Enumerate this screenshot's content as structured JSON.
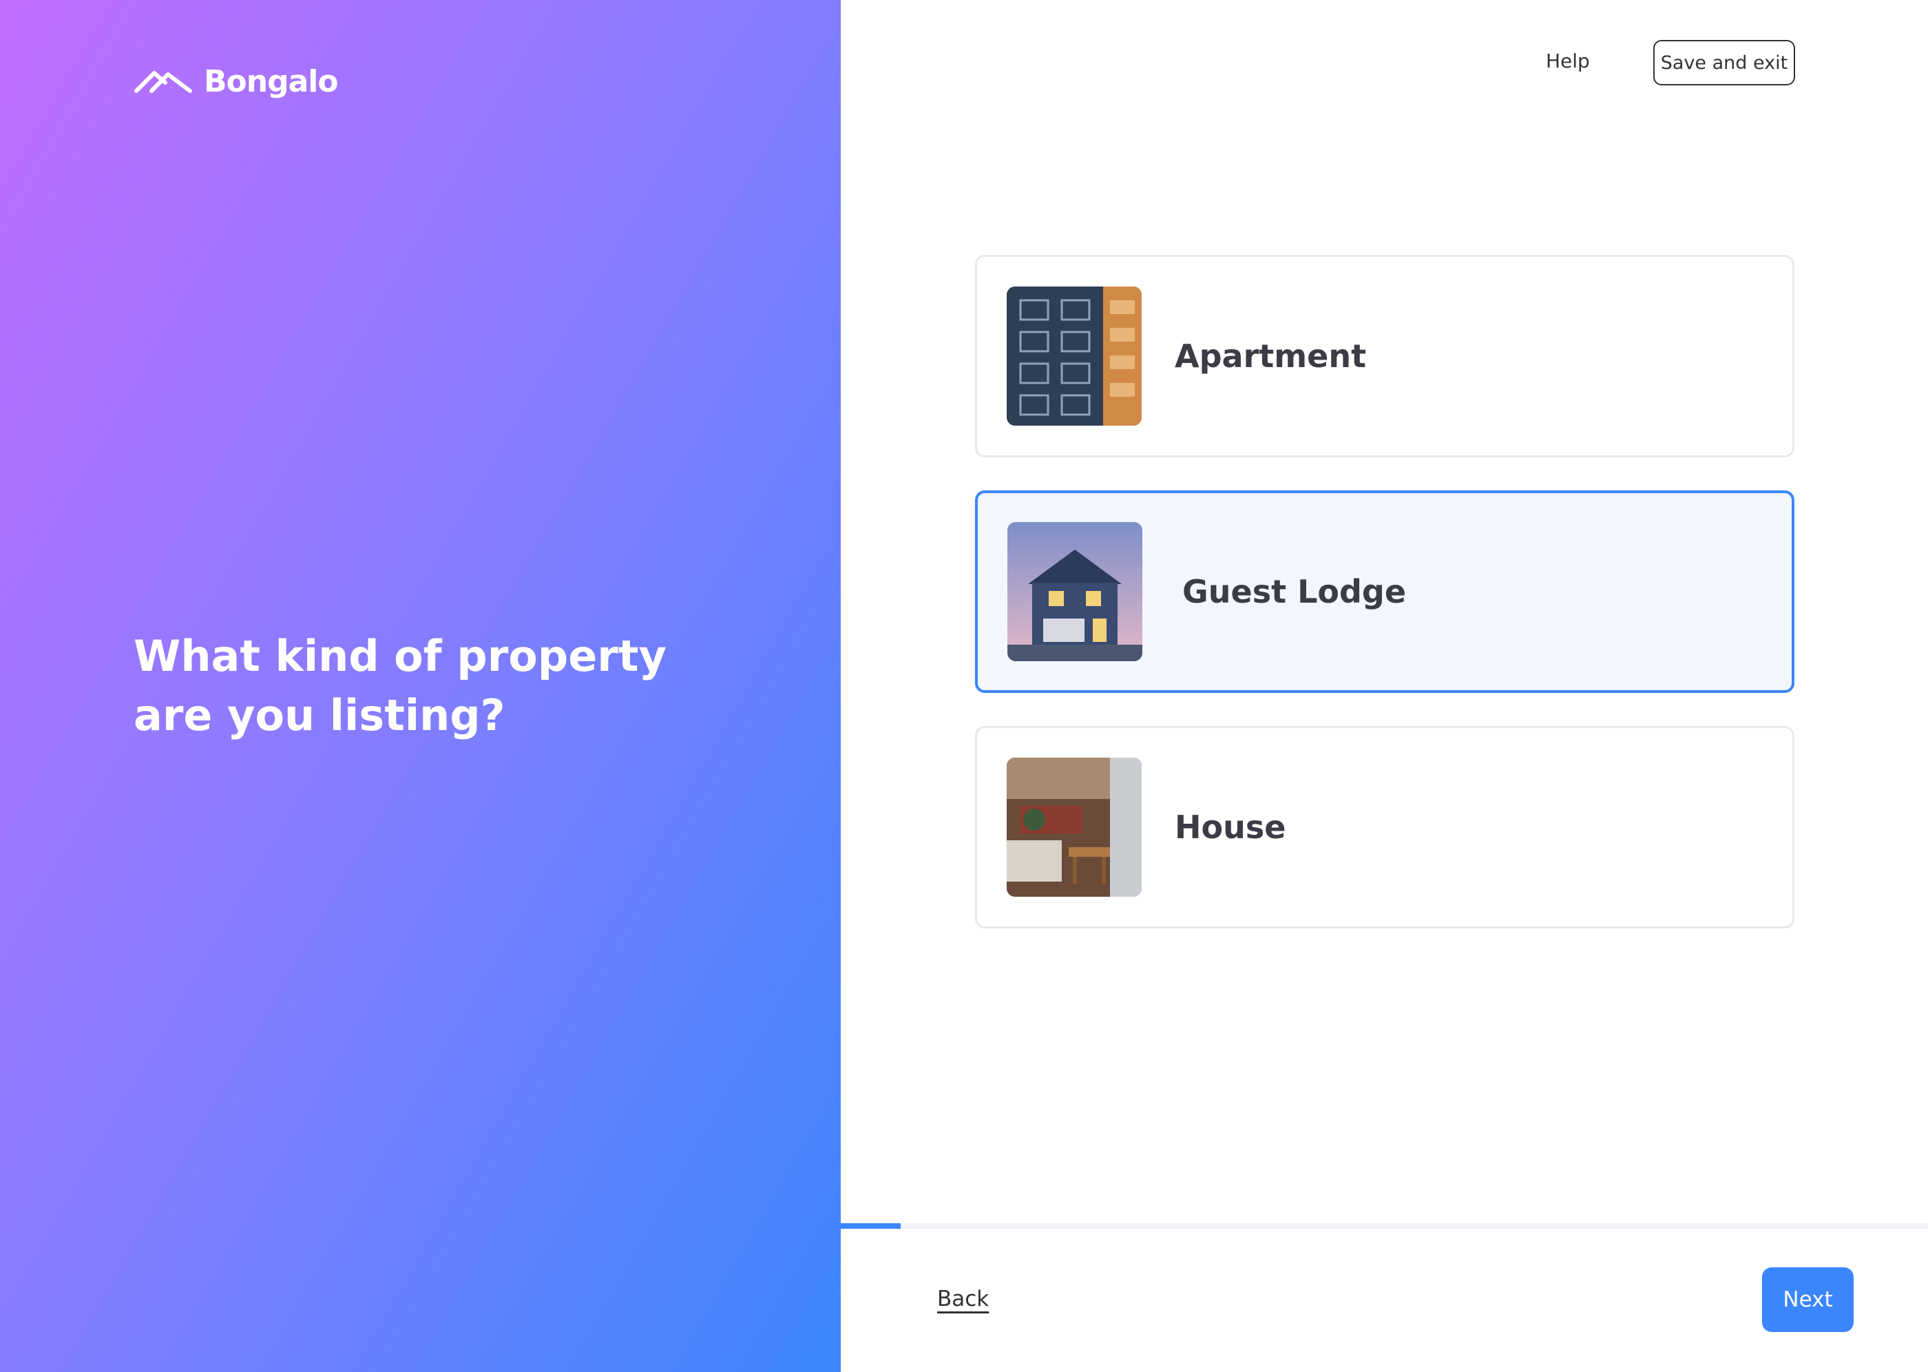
{
  "brand": {
    "name": "Bongalo"
  },
  "hero": {
    "question": "What kind of property are you listing?"
  },
  "header": {
    "help_label": "Help",
    "save_exit_label": "Save and exit"
  },
  "options": [
    {
      "label": "Apartment",
      "selected": false,
      "image": "apartment-building-photo"
    },
    {
      "label": "Guest Lodge",
      "selected": true,
      "image": "guest-lodge-photo"
    },
    {
      "label": "House",
      "selected": false,
      "image": "house-interior-photo"
    }
  ],
  "progress": {
    "fraction": 0.055
  },
  "footer": {
    "back_label": "Back",
    "next_label": "Next"
  },
  "colors": {
    "accent": "#3b86ff",
    "gradient_start": "#c06cff",
    "gradient_end": "#3b86ff"
  }
}
